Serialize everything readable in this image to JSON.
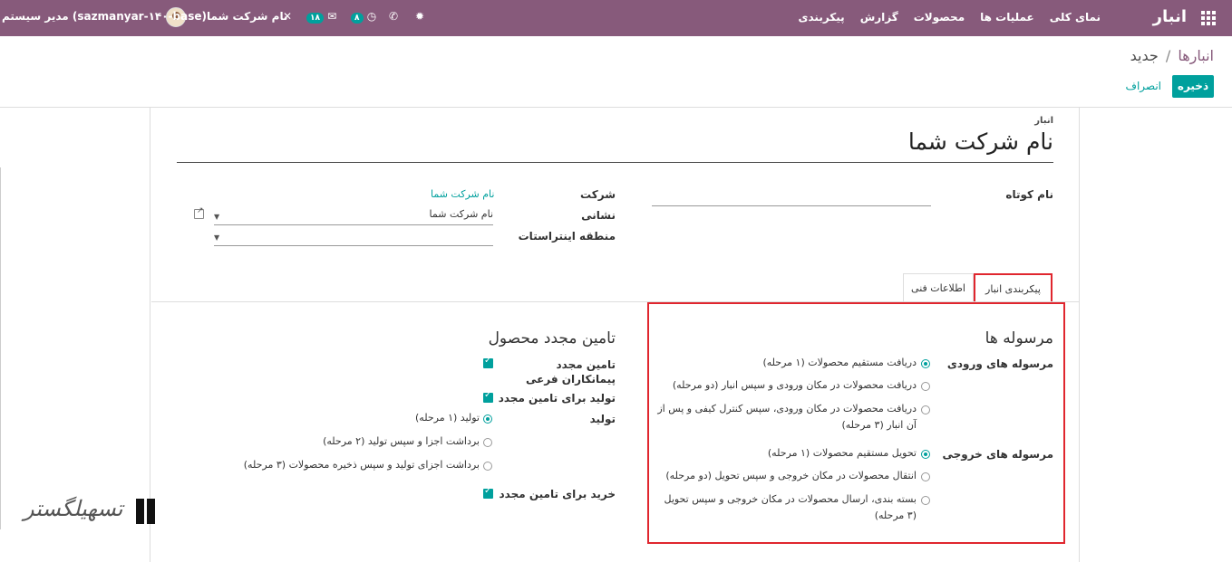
{
  "navbar": {
    "brand": "انبار",
    "menu": [
      "نمای کلی",
      "عملیات ها",
      "محصولات",
      "گزارش",
      "پیکربندی"
    ],
    "company": "نام شرکت شما",
    "user": "مدیر سیستم (sazmanyar-۱۴۰-base)",
    "chat_badge": "۱۸",
    "activity_badge": "۸"
  },
  "breadcrumb": {
    "parent": "انبارها",
    "sep": "/",
    "current": "جدید"
  },
  "buttons": {
    "save": "ذخیره",
    "cancel": "انصراف"
  },
  "form": {
    "title_label": "انبار",
    "title": "نام شرکت شما",
    "shortname_label": "نام کوتاه",
    "company_label": "شرکت",
    "company_value": "نام شرکت شما",
    "address_label": "نشانی",
    "address_value": "نام شرکت شما",
    "tz_label": "منطقه اینتراستات"
  },
  "tabs": [
    "پیکربندی انبار",
    "اطلاعات فنی"
  ],
  "shipments": {
    "title": "مرسوله ها",
    "incoming_label": "مرسوله های ورودی",
    "incoming_options": [
      "دریافت مستقیم محصولات (۱ مرحله)",
      "دریافت محصولات در مکان ورودی و سپس انبار (دو مرحله)",
      "دریافت محصولات در مکان ورودی، سپس کنترل کیفی و پس از آن انبار (۳ مرحله)"
    ],
    "outgoing_label": "مرسوله های خروجی",
    "outgoing_options": [
      "تحویل مستقیم محصولات (۱ مرحله)",
      "انتقال محصولات در مکان خروجی و سپس تحویل (دو مرحله)",
      "بسته بندی، ارسال محصولات در مکان خروجی و سپس تحویل (۳ مرحله)"
    ]
  },
  "resupply": {
    "title": "تامین مجدد محصول",
    "subcontract_label": "تامین مجدد پیمانکاران فرعی",
    "manufacture_resupply_label": "تولید برای تامین مجدد",
    "manufacture_label": "تولید",
    "manufacture_options": [
      "تولید (۱ مرحله)",
      "برداشت اجزا و سپس تولید (۲ مرحله)",
      "برداشت اجزای تولید و سپس ذخیره محصولات (۳ مرحله)"
    ],
    "buy_label": "خرید برای تامین مجدد"
  },
  "colors": {
    "navbar": "#875a7b",
    "accent": "#00a09d",
    "highlight": "#e0262e"
  }
}
